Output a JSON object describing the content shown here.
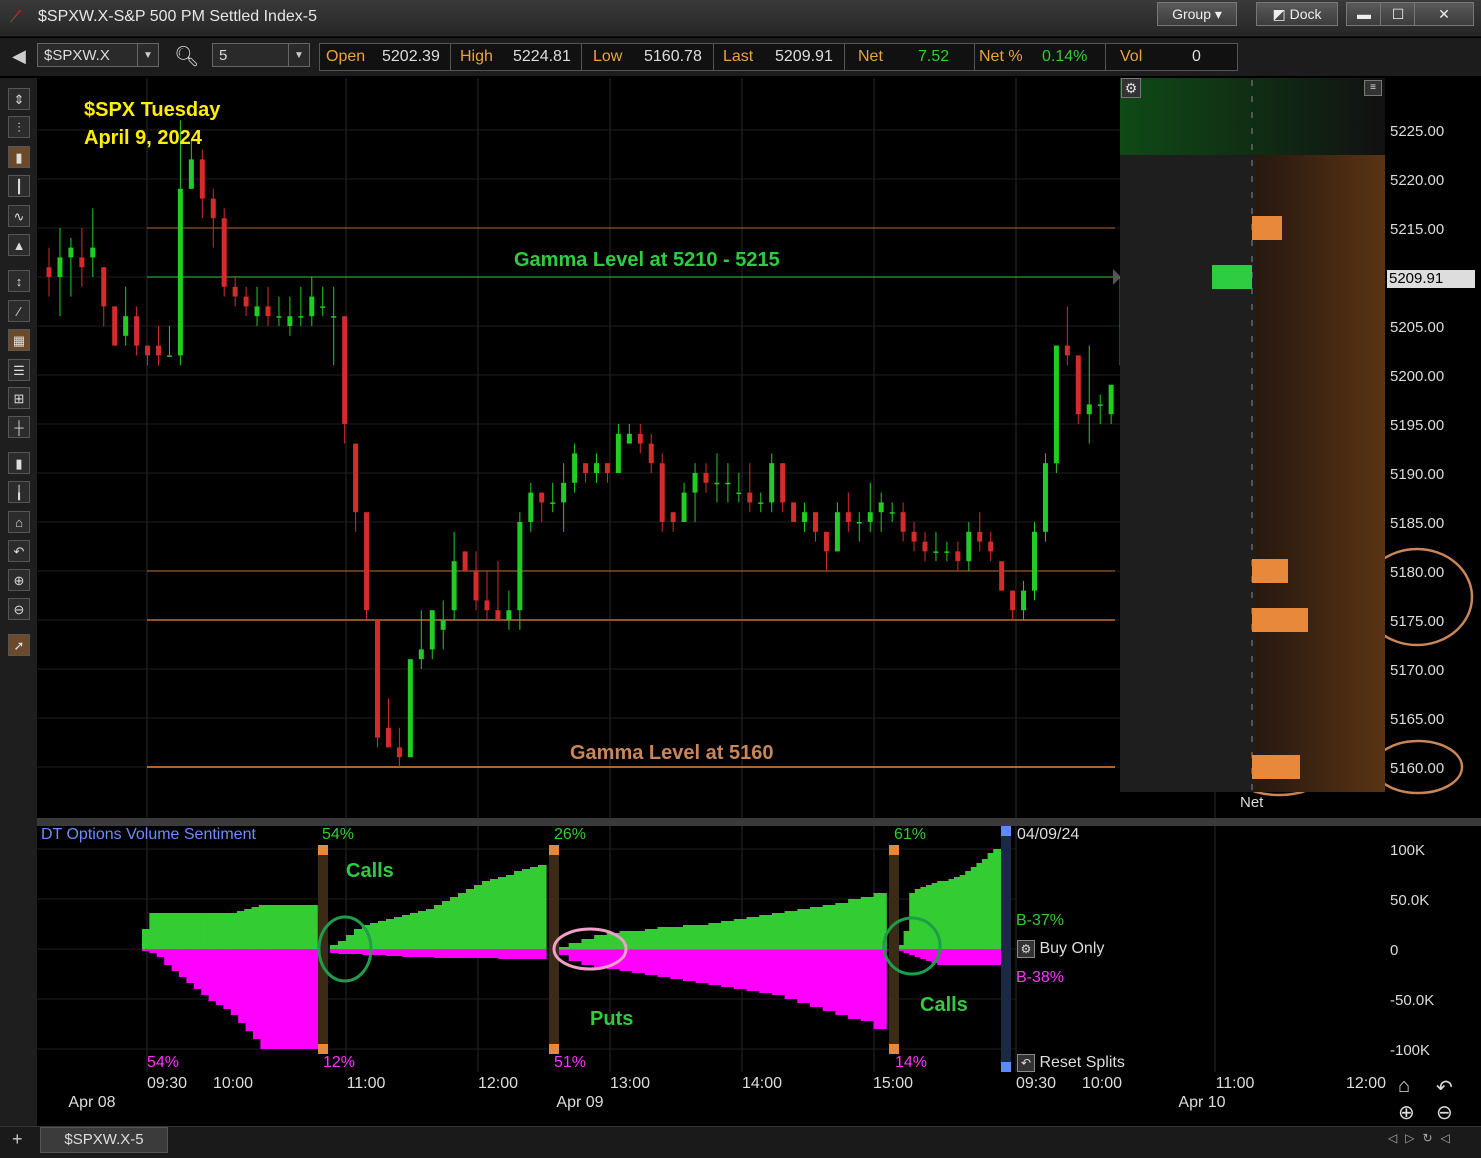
{
  "window": {
    "title": "$SPXW.X-S&P 500 PM Settled Index-5",
    "group_label": "Group",
    "dock_label": "Dock"
  },
  "toolbar": {
    "symbol": "$SPXW.X",
    "interval": "5",
    "quotes": [
      {
        "label": "Open",
        "value": "5202.39"
      },
      {
        "label": "High",
        "value": "5224.81"
      },
      {
        "label": "Low",
        "value": "5160.78"
      },
      {
        "label": "Last",
        "value": "5209.91"
      },
      {
        "label": "Net",
        "value": "7.52"
      },
      {
        "label": "Net %",
        "value": "0.14%"
      },
      {
        "label": "Vol",
        "value": "0"
      }
    ]
  },
  "tab_label": "$SPXW.X-5",
  "colors": {
    "up": "#22cc22",
    "down": "#d42b2b",
    "sentiment_up": "#33cc33",
    "sentiment_down": "#ff00ff",
    "gamma_green": "#2ecc40",
    "gamma_orange": "#e8883a",
    "annotation_yellow": "#ffee00"
  },
  "chart_data": [
    {
      "type": "candlestick",
      "title": "$SPX Tuesday",
      "subtitle": "April 9, 2024",
      "ylim": [
        5156,
        5229
      ],
      "ylabel": "",
      "yticks": [
        "5225.00",
        "5220.00",
        "5215.00",
        "5210.00",
        "5205.00",
        "5200.00",
        "5195.00",
        "5190.00",
        "5185.00",
        "5180.00",
        "5175.00",
        "5170.00",
        "5165.00",
        "5160.00"
      ],
      "last_price_label": "5209.91",
      "time_labels": [
        "09:30",
        "10:00",
        "11:00",
        "12:00",
        "13:00",
        "14:00",
        "15:00",
        "09:30",
        "10:00",
        "11:00",
        "12:00"
      ],
      "date_labels": [
        "Apr 08",
        "Apr 09",
        "Apr 10"
      ],
      "candles": [
        [
          5211,
          5213,
          5208,
          5210
        ],
        [
          5210,
          5215,
          5206,
          5212
        ],
        [
          5212,
          5214,
          5208,
          5213
        ],
        [
          5212,
          5215,
          5209,
          5211
        ],
        [
          5212,
          5217,
          5210,
          5213
        ],
        [
          5211,
          5211,
          5205,
          5207
        ],
        [
          5207,
          5207,
          5203,
          5203
        ],
        [
          5204,
          5209,
          5203,
          5206
        ],
        [
          5206,
          5207,
          5202,
          5203
        ],
        [
          5203,
          5203,
          5201,
          5202
        ],
        [
          5203,
          5205,
          5201,
          5202
        ],
        [
          5202,
          5205,
          5202,
          5202
        ],
        [
          5202,
          5226,
          5201,
          5219
        ],
        [
          5219,
          5224,
          5219,
          5222
        ],
        [
          5222,
          5223,
          5216,
          5218
        ],
        [
          5218,
          5219,
          5213,
          5216
        ],
        [
          5216,
          5217,
          5208,
          5209
        ],
        [
          5209,
          5210,
          5207,
          5208
        ],
        [
          5208,
          5209,
          5206,
          5207
        ],
        [
          5206,
          5209,
          5205,
          5207
        ],
        [
          5207,
          5209,
          5205,
          5206
        ],
        [
          5206,
          5208,
          5205,
          5206
        ],
        [
          5205,
          5208,
          5204,
          5206
        ],
        [
          5206,
          5209,
          5205,
          5206
        ],
        [
          5206,
          5210,
          5205,
          5208
        ],
        [
          5207,
          5209,
          5206,
          5207
        ],
        [
          5206,
          5209,
          5201,
          5206
        ],
        [
          5206,
          5206,
          5193,
          5195
        ],
        [
          5193,
          5193,
          5184,
          5186
        ],
        [
          5186,
          5186,
          5175,
          5176
        ],
        [
          5175,
          5175,
          5162,
          5163
        ],
        [
          5164,
          5167,
          5162,
          5162
        ],
        [
          5162,
          5164,
          5160,
          5161
        ],
        [
          5161,
          5171,
          5161,
          5171
        ],
        [
          5171,
          5176,
          5170,
          5172
        ],
        [
          5172,
          5175,
          5171,
          5176
        ],
        [
          5174,
          5177,
          5172,
          5175
        ],
        [
          5176,
          5184,
          5175,
          5181
        ],
        [
          5182,
          5182,
          5180,
          5180
        ],
        [
          5180,
          5182,
          5176,
          5177
        ],
        [
          5177,
          5180,
          5175,
          5176
        ],
        [
          5176,
          5181,
          5175,
          5175
        ],
        [
          5175,
          5178,
          5174,
          5176
        ],
        [
          5176,
          5186,
          5174,
          5185
        ],
        [
          5185,
          5189,
          5184,
          5188
        ],
        [
          5188,
          5188,
          5185,
          5187
        ],
        [
          5187,
          5189,
          5186,
          5187
        ],
        [
          5187,
          5191,
          5184,
          5189
        ],
        [
          5189,
          5193,
          5188,
          5192
        ],
        [
          5191,
          5191,
          5189,
          5190
        ],
        [
          5190,
          5192,
          5189,
          5191
        ],
        [
          5191,
          5191,
          5189,
          5190
        ],
        [
          5190,
          5195,
          5190,
          5194
        ],
        [
          5193,
          5195,
          5193,
          5194
        ],
        [
          5194,
          5195,
          5192,
          5193
        ],
        [
          5193,
          5194,
          5190,
          5191
        ],
        [
          5191,
          5192,
          5184,
          5185
        ],
        [
          5186,
          5186,
          5184,
          5185
        ],
        [
          5185,
          5189,
          5185,
          5188
        ],
        [
          5188,
          5191,
          5185,
          5190
        ],
        [
          5190,
          5191,
          5188,
          5189
        ],
        [
          5189,
          5192,
          5187,
          5189
        ],
        [
          5189,
          5191,
          5187,
          5189
        ],
        [
          5188,
          5190,
          5187,
          5188
        ],
        [
          5188,
          5191,
          5186,
          5187
        ],
        [
          5187,
          5188,
          5186,
          5187
        ],
        [
          5187,
          5192,
          5186,
          5191
        ],
        [
          5191,
          5191,
          5186,
          5187
        ],
        [
          5187,
          5187,
          5185,
          5185
        ],
        [
          5185,
          5187,
          5184,
          5186
        ],
        [
          5186,
          5186,
          5183,
          5184
        ],
        [
          5184,
          5184,
          5180,
          5182
        ],
        [
          5182,
          5187,
          5182,
          5186
        ],
        [
          5186,
          5188,
          5184,
          5185
        ],
        [
          5185,
          5186,
          5183,
          5185
        ],
        [
          5185,
          5189,
          5184,
          5186
        ],
        [
          5186,
          5188,
          5184,
          5187
        ],
        [
          5186,
          5187,
          5185,
          5186
        ],
        [
          5186,
          5187,
          5183,
          5184
        ],
        [
          5184,
          5185,
          5182,
          5183
        ],
        [
          5183,
          5184,
          5181,
          5182
        ],
        [
          5182,
          5184,
          5181,
          5182
        ],
        [
          5182,
          5183,
          5181,
          5182
        ],
        [
          5182,
          5183,
          5180,
          5181
        ],
        [
          5181,
          5185,
          5180,
          5184
        ],
        [
          5184,
          5186,
          5182,
          5183
        ],
        [
          5183,
          5184,
          5181,
          5182
        ],
        [
          5181,
          5181,
          5178,
          5178
        ],
        [
          5178,
          5178,
          5175,
          5176
        ],
        [
          5176,
          5179,
          5175,
          5178
        ],
        [
          5178,
          5185,
          5177,
          5184
        ],
        [
          5184,
          5192,
          5183,
          5191
        ],
        [
          5191,
          5203,
          5190,
          5203
        ],
        [
          5203,
          5207,
          5201,
          5202
        ],
        [
          5202,
          5202,
          5195,
          5196
        ],
        [
          5196,
          5203,
          5193,
          5197
        ],
        [
          5197,
          5198,
          5195,
          5197
        ],
        [
          5196,
          5199,
          5195,
          5199
        ],
        [
          5201,
          5211,
          5201,
          5210
        ]
      ],
      "gamma_levels": [
        {
          "label": "Gamma Level at 5210 - 5215",
          "value": 5210,
          "color": "#2ecc40"
        },
        {
          "label": "Gamma Level at 5160",
          "value": 5160,
          "color": "#e8883a"
        }
      ],
      "reference_lines": [
        5215,
        5180,
        5175
      ],
      "net_panel": {
        "label": "Net",
        "bars": [
          {
            "price": 5215,
            "value": 30,
            "sign": "orange"
          },
          {
            "price": 5210,
            "value": 40,
            "sign": "green"
          },
          {
            "price": 5180,
            "value": 36,
            "sign": "orange"
          },
          {
            "price": 5175,
            "value": 56,
            "sign": "orange"
          },
          {
            "price": 5160,
            "value": 48,
            "sign": "orange"
          }
        ]
      }
    },
    {
      "type": "area",
      "title": "DT Options Volume Sentiment",
      "ylim": [
        -100000,
        100000
      ],
      "yticks": [
        "100K",
        "50.0K",
        "0",
        "-50.0K",
        "-100K"
      ],
      "date_label": "04/09/24",
      "buy_only_label": "Buy Only",
      "reset_splits_label": "Reset Splits",
      "b_up_label": "B-37%",
      "b_down_label": "B-38%",
      "segment_top_pct": [
        "54%",
        "26%",
        "61%"
      ],
      "segment_bottom_pct": [
        "54%",
        "12%",
        "51%",
        "14%"
      ],
      "annotations": [
        "Calls",
        "Puts",
        "Calls"
      ],
      "series": [
        {
          "name": "",
          "values": [
            20000,
            36000,
            36000,
            36000,
            36000,
            36000,
            36000,
            36000,
            36000,
            36000,
            36000,
            36000,
            36000,
            38000,
            40000,
            42000,
            44000,
            44000,
            44000,
            44000,
            44000,
            44000,
            44000,
            44000
          ]
        },
        {
          "name": "",
          "values": [
            -2000,
            -4000,
            -8000,
            -16000,
            -22000,
            -28000,
            -34000,
            -40000,
            -46000,
            -52000,
            -56000,
            -60000,
            -66000,
            -74000,
            -82000,
            -90000,
            -100000,
            -100000,
            -100000,
            -100000,
            -100000,
            -100000,
            -100000,
            -100000
          ]
        },
        {
          "name": "",
          "values": [
            4000,
            8000,
            14000,
            20000,
            24000,
            26000,
            28000,
            30000,
            32000,
            34000,
            36000,
            38000,
            40000,
            44000,
            48000,
            52000,
            56000,
            60000,
            64000,
            68000,
            70000,
            72000,
            74000,
            78000,
            80000,
            82000,
            84000
          ]
        },
        {
          "name": "",
          "values": [
            -4000,
            -5000,
            -5000,
            -5000,
            -6000,
            -6000,
            -6000,
            -7000,
            -7000,
            -8000,
            -8000,
            -8000,
            -8000,
            -9000,
            -9000,
            -9000,
            -9000,
            -9000,
            -9000,
            -9000,
            -9000,
            -10000,
            -10000,
            -10000,
            -10000,
            -10000,
            -10000
          ]
        },
        {
          "name": "",
          "values": [
            2000,
            6000,
            10000,
            14000,
            16000,
            18000,
            18000,
            20000,
            22000,
            22000,
            24000,
            24000,
            26000,
            28000,
            30000,
            32000,
            34000,
            36000,
            38000,
            40000,
            42000,
            44000,
            46000,
            50000,
            52000,
            56000
          ]
        },
        {
          "name": "",
          "values": [
            -6000,
            -12000,
            -16000,
            -18000,
            -20000,
            -22000,
            -24000,
            -26000,
            -28000,
            -30000,
            -32000,
            -34000,
            -36000,
            -38000,
            -40000,
            -42000,
            -44000,
            -46000,
            -50000,
            -54000,
            -58000,
            -62000,
            -66000,
            -70000,
            -72000,
            -80000
          ]
        },
        {
          "name": "",
          "values": [
            10000,
            18000,
            28000,
            34000,
            40000,
            48000,
            56000,
            62000,
            68000,
            74000,
            78000,
            82000,
            84000,
            86000,
            88000,
            90000,
            92000,
            96000,
            100000,
            102000,
            104000,
            106000,
            108000,
            110000,
            112000,
            114000
          ]
        },
        {
          "name": "",
          "values": [
            -2000,
            -4000,
            -6000,
            -8000,
            -10000,
            -12000,
            -14000,
            -16000,
            -18000,
            -20000,
            -22000,
            -24000,
            -26000,
            -28000,
            -30000,
            -32000,
            -34000,
            -36000,
            -38000,
            -40000,
            -42000,
            -44000,
            -46000,
            -48000,
            -50000,
            -52000
          ]
        },
        {
          "name": "",
          "values": [
            4000,
            18000,
            56000,
            60000,
            62000,
            64000,
            66000,
            68000,
            68000,
            70000,
            72000,
            74000,
            78000,
            82000,
            86000,
            90000,
            96000,
            100000,
            100000,
            100000
          ]
        },
        {
          "name": "",
          "values": [
            -2000,
            -4000,
            -6000,
            -8000,
            -10000,
            -12000,
            -14000,
            -16000,
            -16000,
            -16000,
            -16000,
            -16000,
            -16000,
            -16000,
            -16000,
            -16000,
            -16000,
            -16000,
            -16000,
            -16000
          ]
        }
      ]
    }
  ]
}
